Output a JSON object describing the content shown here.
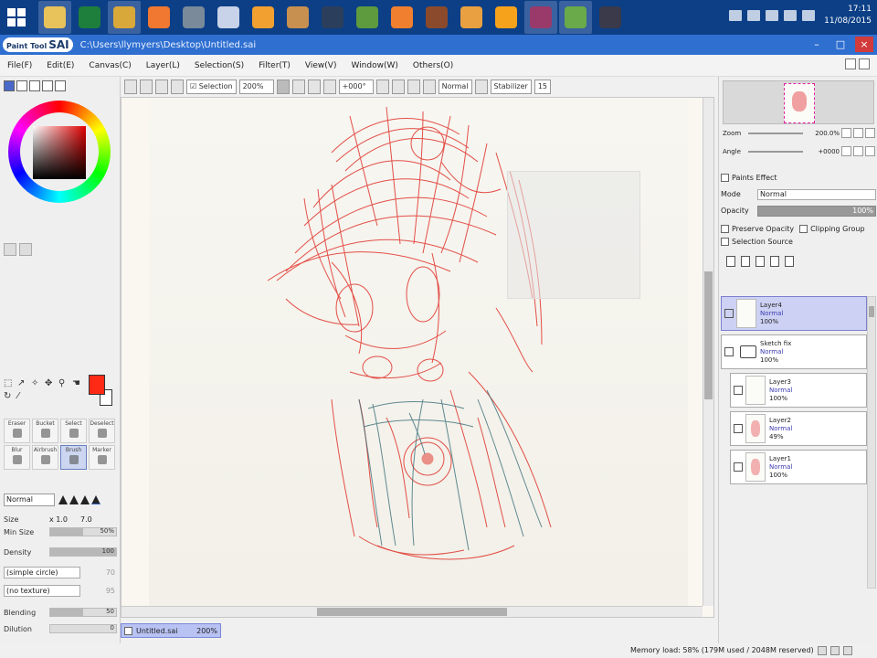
{
  "taskbar": {
    "apps": [
      {
        "name": "file-explorer",
        "color": "#e8c25a",
        "active": true
      },
      {
        "name": "excel",
        "color": "#1e7e3c",
        "active": false
      },
      {
        "name": "chrome",
        "color": "#d9a83a",
        "active": true
      },
      {
        "name": "paint-sai-orange",
        "color": "#f07830",
        "active": false
      },
      {
        "name": "app-bird",
        "color": "#7a8a9a",
        "active": false
      },
      {
        "name": "app-palette",
        "color": "#c8d2e8",
        "active": false
      },
      {
        "name": "app-flame",
        "color": "#f2a030",
        "active": false
      },
      {
        "name": "app-tools",
        "color": "#c89050",
        "active": false
      },
      {
        "name": "steam",
        "color": "#2b3e5c",
        "active": false
      },
      {
        "name": "minecraft",
        "color": "#5e9a3e",
        "active": false
      },
      {
        "name": "app-fox",
        "color": "#f08030",
        "active": false
      },
      {
        "name": "app-game-face",
        "color": "#8b4a2b",
        "active": false
      },
      {
        "name": "app-house",
        "color": "#e8a040",
        "active": false
      },
      {
        "name": "media-player",
        "color": "#f7a21b",
        "active": false
      },
      {
        "name": "app-winrar",
        "color": "#9a3a6a",
        "active": true
      },
      {
        "name": "app-globe",
        "color": "#6aaa4a",
        "active": true
      },
      {
        "name": "app-dark",
        "color": "#3a3a4a",
        "active": false
      }
    ],
    "clock_time": "17:11",
    "clock_date": "11/08/2015"
  },
  "window": {
    "app_logo": "Paint Tool",
    "app_logo_bold": "SAI",
    "file_path": "C:\\Users\\llymyers\\Desktop\\Untitled.sai",
    "controls": [
      "–",
      "□",
      "×"
    ]
  },
  "menu": [
    "File(F)",
    "Edit(E)",
    "Canvas(C)",
    "Layer(L)",
    "Selection(S)",
    "Filter(T)",
    "View(V)",
    "Window(W)",
    "Others(O)"
  ],
  "toolbar": {
    "selection_label": "Selection",
    "zoom": "200%",
    "angle": "+000°",
    "mode": "Normal",
    "stabilizer_label": "Stabilizer",
    "stabilizer_value": "15"
  },
  "left": {
    "brushes": [
      "Eraser",
      "Bucket",
      "Select",
      "Deselect",
      "Blur",
      "Airbrush",
      "Brush",
      "Marker"
    ],
    "selected_brush": "Brush",
    "blend_mode": "Normal",
    "size_label": "Size",
    "size_mult": "x 1.0",
    "size_value": "7.0",
    "min_size_label": "Min Size",
    "min_size_value": "50%",
    "min_size_fraction": 0.5,
    "density_label": "Density",
    "density_value": "100",
    "density_fraction": 1.0,
    "shape_combo": "(simple circle)",
    "shape_value": "70",
    "texture_combo": "(no texture)",
    "texture_value": "95",
    "blending_label": "Blending",
    "blending_value": "50",
    "blending_fraction": 0.5,
    "dilution_label": "Dilution",
    "dilution_value": "0",
    "fg_color": "#ff2a16",
    "bg_color": "#ffffff"
  },
  "filetab": {
    "name": "Untitled.sai",
    "zoom": "200%"
  },
  "status": "Memory load: 58% (179M used / 2048M reserved)",
  "right": {
    "zoom_label": "Zoom",
    "zoom_value": "200.0%",
    "angle_label": "Angle",
    "angle_value": "+0000",
    "paint_effect_label": "Paints Effect",
    "mode_label": "Mode",
    "mode_value": "Normal",
    "opacity_label": "Opacity",
    "opacity_value": "100%",
    "preserve_opacity": "Preserve Opacity",
    "clipping_group": "Clipping Group",
    "selection_source": "Selection Source",
    "layers": [
      {
        "name": "Layer4",
        "mode": "Normal",
        "opacity": "100%",
        "type": "layer",
        "selected": true,
        "thumb": "blank"
      },
      {
        "name": "Sketch fix",
        "mode": "Normal",
        "opacity": "100%",
        "type": "folder",
        "selected": false,
        "thumb": "folder"
      },
      {
        "name": "Layer3",
        "mode": "Normal",
        "opacity": "100%",
        "type": "layer",
        "selected": false,
        "thumb": "blank"
      },
      {
        "name": "Layer2",
        "mode": "Normal",
        "opacity": "49%",
        "type": "layer",
        "selected": false,
        "thumb": "pink"
      },
      {
        "name": "Layer1",
        "mode": "Normal",
        "opacity": "100%",
        "type": "layer",
        "selected": false,
        "thumb": "pink"
      }
    ]
  },
  "sketch_colors": {
    "red": "#e0322a",
    "teal": "#3a6e78"
  }
}
